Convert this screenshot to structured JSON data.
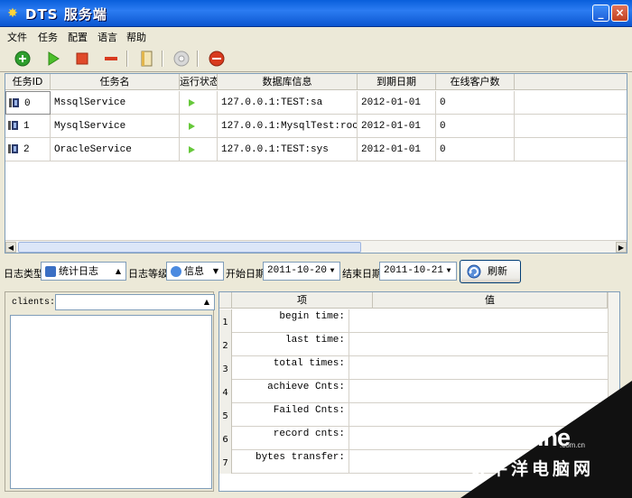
{
  "window": {
    "title": "DTS 服务端",
    "btn_min": "_",
    "btn_max": "□",
    "btn_close": "×"
  },
  "menu": [
    "文件",
    "任务",
    "配置",
    "语言",
    "帮助"
  ],
  "toolbar": {
    "icons": [
      "add-icon",
      "play-icon",
      "stop-icon",
      "remove-icon",
      "book-icon",
      "settings-icon",
      "exit-icon"
    ],
    "colors": {
      "add": "#2E9E2E",
      "play": "#4CBF2A",
      "stop": "#E04A2A",
      "remove": "#D83A1E",
      "exit": "#D83A1E"
    }
  },
  "tasks": {
    "headers": [
      "任务ID",
      "任务名",
      "运行状态",
      "数据库信息",
      "到期日期",
      "在线客户数"
    ],
    "rows": [
      {
        "id": "0",
        "name": "MssqlService",
        "db": "127.0.0.1:TEST:sa",
        "expire": "2012-01-01",
        "clients": "0"
      },
      {
        "id": "1",
        "name": "MysqlService",
        "db": "127.0.0.1:MysqlTest:root",
        "expire": "2012-01-01",
        "clients": "0"
      },
      {
        "id": "2",
        "name": "OracleService",
        "db": "127.0.0.1:TEST:sys",
        "expire": "2012-01-01",
        "clients": "0"
      }
    ]
  },
  "filter": {
    "log_type_label": "日志类型",
    "log_type_value": "统计日志",
    "log_level_label": "日志等级",
    "log_level_value": "信息",
    "start_label": "开始日期",
    "start_value": "2011-10-20",
    "end_label": "结束日期",
    "end_value": "2011-10-21",
    "refresh_label": "刷新"
  },
  "clients": {
    "label": "clients:"
  },
  "stats": {
    "headers": [
      "项",
      "值"
    ],
    "rows": [
      {
        "num": "1",
        "key": "begin time:"
      },
      {
        "num": "2",
        "key": "last time:"
      },
      {
        "num": "3",
        "key": "total times:"
      },
      {
        "num": "4",
        "key": "achieve Cnts:"
      },
      {
        "num": "5",
        "key": "Failed Cnts:"
      },
      {
        "num": "6",
        "key": "record cnts:"
      },
      {
        "num": "7",
        "key": "bytes transfer:"
      }
    ]
  },
  "watermark": {
    "brand": "PConline",
    "domain": ".com.cn",
    "chinese": "太平洋电脑网"
  }
}
